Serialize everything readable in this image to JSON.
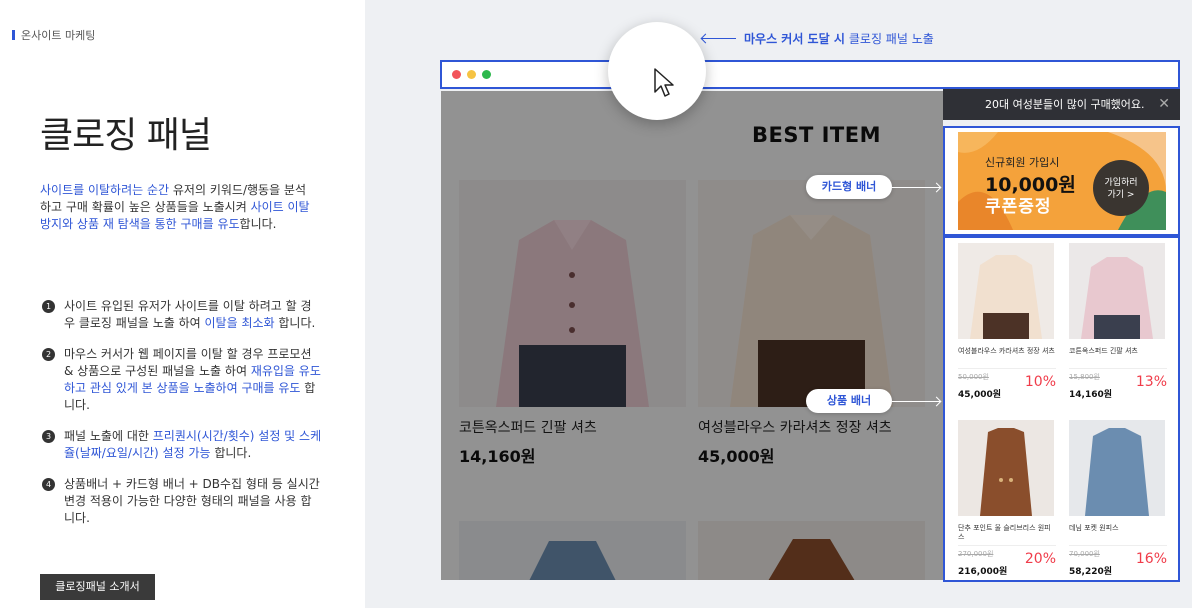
{
  "breadcrumb": "온사이트 마케팅",
  "title": "클로징 패널",
  "intro": {
    "hl1": "사이트를 이탈하려는 순간",
    "t1": " 유저의 키워드/행동을 분석하고 구매 확률이 높은 상품들을 노출시켜 ",
    "hl2": "사이트 이탈 방지와 상품 재 탐색을 통한 구매를 유도",
    "t2": "합니다."
  },
  "steps": [
    {
      "num": "1",
      "a": "사이트 유입된 유저가 사이트를 이탈 하려고 할 경우 클로징 패널을 노출 하여 ",
      "hl": "이탈을 최소화",
      "b": " 합니다."
    },
    {
      "num": "2",
      "a": "마우스 커서가 웹 페이지를 이탈 할 경우 프로모션 & 상품으로 구성된 패널을 노출 하여 ",
      "hl": "재유입을 유도하고 관심 있게 본 상품을 노출하여 구매를 유도",
      "b": " 합니다."
    },
    {
      "num": "3",
      "a": "패널 노출에 대한 ",
      "hl": "프리퀀시(시간/횟수) 설정 및 스케쥴(날짜/요일/시간) 설정 가능",
      "b": " 합니다."
    },
    {
      "num": "4",
      "a": "상품배너 + 카드형 배너 + DB수집 형태 등 실시간 변경 적용이 가능한 다양한 형태의 패널을 사용 합니다.",
      "hl": "",
      "b": ""
    }
  ],
  "intro_button": "클로징패널 소개서",
  "callout": {
    "bold": "마우스 커서 도달 시",
    "rest": "클로징 패널 노출"
  },
  "page": {
    "best_title": "BEST ITEM",
    "products": [
      {
        "name": "코튼옥스퍼드 긴팔 셔츠",
        "price": "14,160원"
      },
      {
        "name": "여성블라우스 카라셔츠 정장 셔츠",
        "price": "45,000원"
      }
    ]
  },
  "panel": {
    "header": "20대 여성분들이 많이 구매했어요.",
    "close": "✕",
    "card": {
      "line1": "신규회원 가입시",
      "amount": "10,000원",
      "coupon": "쿠폰증정",
      "button_l1": "가입하러",
      "button_l2": "가기 >"
    },
    "products": [
      {
        "name": "여성블라우스 카라셔츠 정장 셔츠",
        "old": "50,000원",
        "new": "45,000원",
        "disc": "10%"
      },
      {
        "name": "코튼옥스퍼드 긴팔 셔츠",
        "old": "15,800원",
        "new": "14,160원",
        "disc": "13%"
      },
      {
        "name": "단추 포인트 울 슬리브리스 원피스",
        "old": "270,000원",
        "new": "216,000원",
        "disc": "20%"
      },
      {
        "name": "데님 포켓 원피스",
        "old": "70,000원",
        "new": "58,220원",
        "disc": "16%"
      }
    ]
  },
  "labels": {
    "card_banner": "카드형 배너",
    "product_banner": "상품 배너"
  },
  "colors": {
    "accent": "#2f56d6",
    "discount": "#f03c4a",
    "panel_header": "#2f3036"
  }
}
